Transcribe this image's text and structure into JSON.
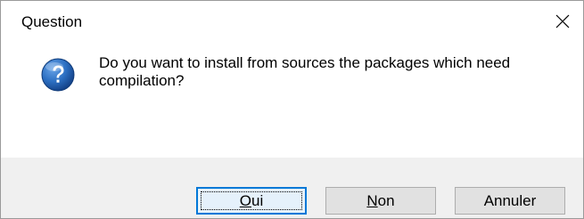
{
  "window": {
    "title": "Question",
    "close_icon": "close-icon"
  },
  "message": {
    "icon": "question-icon",
    "icon_color": "#1d5fa8",
    "line1": "Do you want to install from sources the packages which need",
    "line2": "compilation?"
  },
  "buttons": {
    "yes": {
      "mnemonic": "O",
      "rest": "ui",
      "label": "Oui"
    },
    "no": {
      "mnemonic": "N",
      "rest": "on",
      "label": "Non"
    },
    "cancel": {
      "label": "Annuler"
    }
  },
  "colors": {
    "focus_border": "#0078d7",
    "button_face": "#e1e1e1"
  }
}
